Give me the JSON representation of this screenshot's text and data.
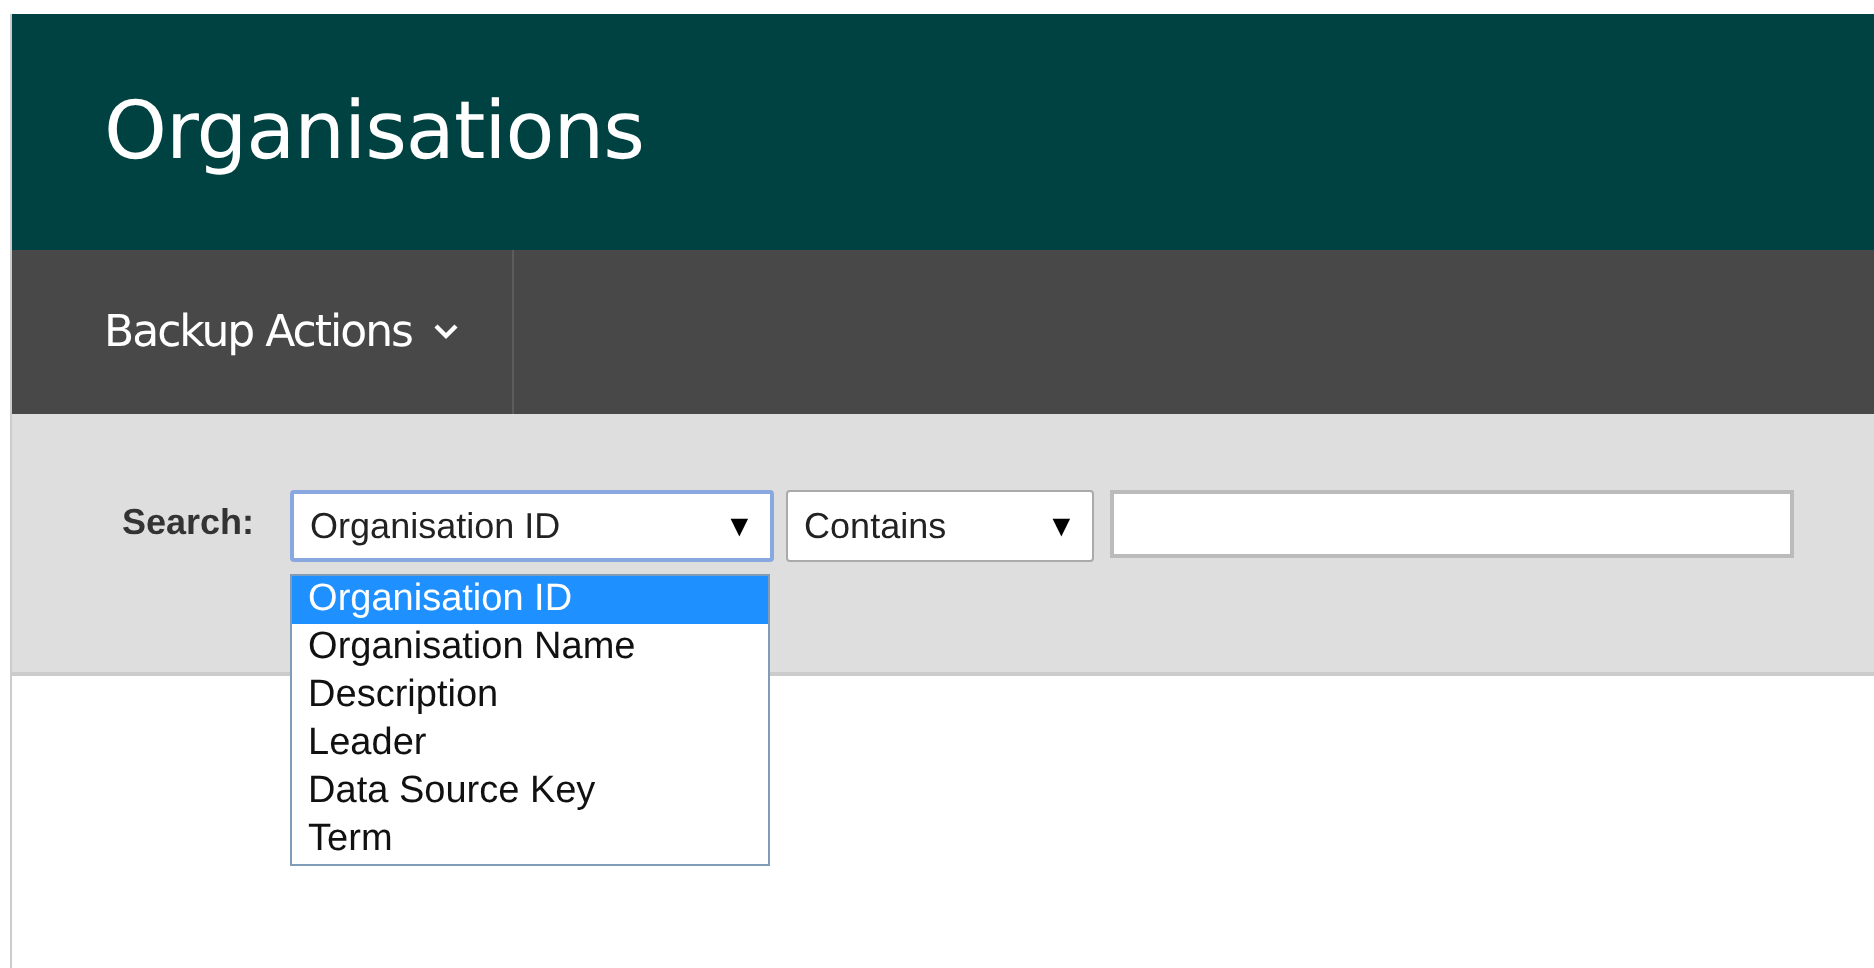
{
  "header": {
    "title": "Organisations"
  },
  "nav": {
    "items": [
      {
        "label": "Backup Actions",
        "kind": "menu"
      }
    ]
  },
  "search": {
    "label": "Search:",
    "field_select": {
      "value": "Organisation ID",
      "arrow": "▼",
      "expanded": true,
      "options": [
        {
          "label": "Organisation ID",
          "selected": true
        },
        {
          "label": "Organisation Name",
          "selected": false
        },
        {
          "label": "Description",
          "selected": false
        },
        {
          "label": "Leader",
          "selected": false
        },
        {
          "label": "Data Source Key",
          "selected": false
        },
        {
          "label": "Term",
          "selected": false
        }
      ]
    },
    "operator_select": {
      "value": "Contains",
      "arrow": "▼"
    }
  }
}
